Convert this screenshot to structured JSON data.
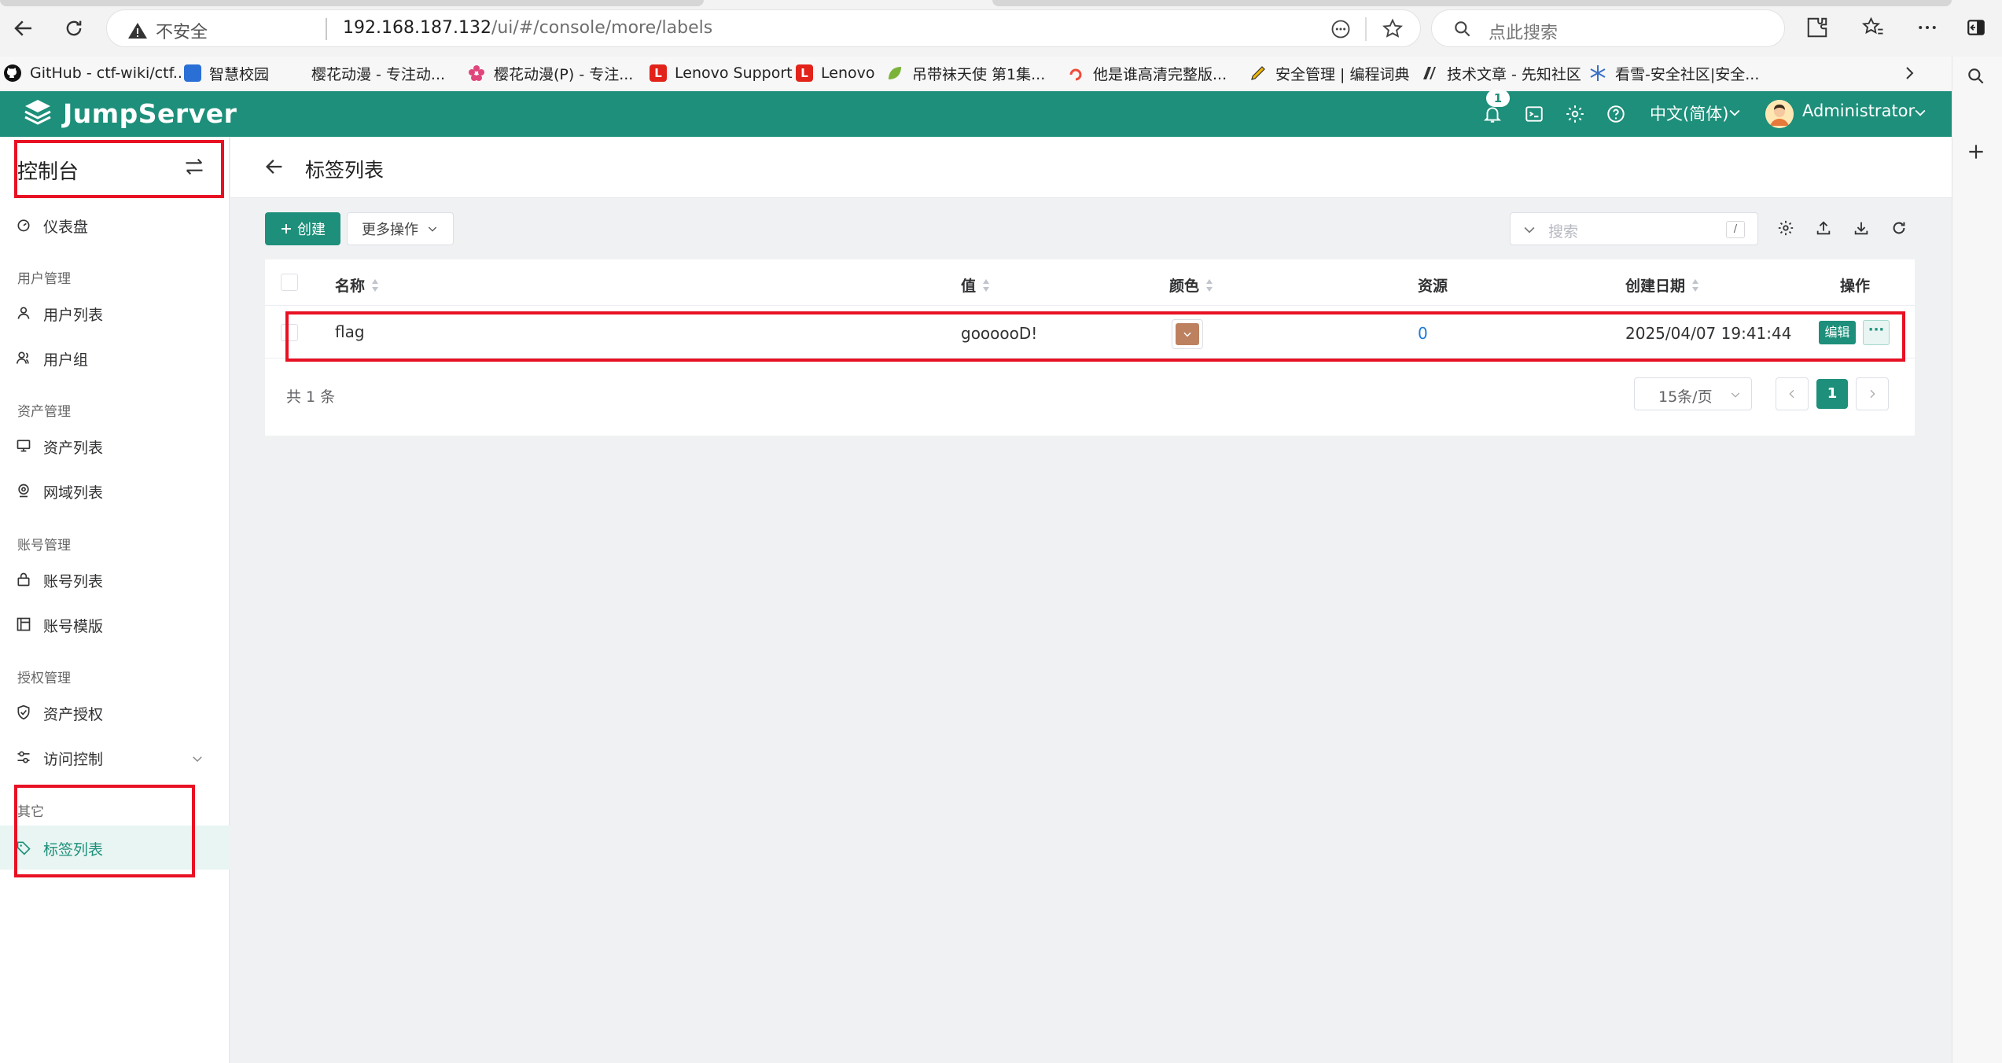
{
  "browser": {
    "insecure_label": "不安全",
    "url_host": "192.168.187.132",
    "url_path": "/ui/#/console/more/labels",
    "search_placeholder": "点此搜索"
  },
  "bookmarks": [
    {
      "label": "GitHub - ctf-wiki/ctf...",
      "icon": "github-icon",
      "color": "#111111"
    },
    {
      "label": "智慧校园",
      "icon": "campus-icon",
      "color": "#2a6fd6"
    },
    {
      "label": "樱花动漫 - 专注动...",
      "icon": "blank-icon",
      "color": "#f7f7f7"
    },
    {
      "label": "樱花动漫(P) - 专注...",
      "icon": "sakura-icon",
      "color": "#e0457b"
    },
    {
      "label": "Lenovo Support",
      "icon": "lenovo-icon",
      "color": "#e2231a"
    },
    {
      "label": "Lenovo",
      "icon": "lenovo-icon",
      "color": "#e2231a"
    },
    {
      "label": "吊带袜天使 第1集...",
      "icon": "leaf-icon",
      "color": "#7bb33a"
    },
    {
      "label": "他是谁高清完整版...",
      "icon": "swirl-icon",
      "color": "#ef4b3b"
    },
    {
      "label": "安全管理 | 编程词典",
      "icon": "pen-icon",
      "color": "#f2b705"
    },
    {
      "label": "技术文章 - 先知社区",
      "icon": "slash-icon",
      "color": "#333333"
    },
    {
      "label": "看雪-安全社区|安全...",
      "icon": "snow-icon",
      "color": "#3a6fc4"
    }
  ],
  "header": {
    "brand": "JumpServer",
    "notification_count": "1",
    "language": "中文(简体)",
    "user": "Administrator",
    "brand_color": "#1d8f7a"
  },
  "sidebar": {
    "title": "控制台",
    "dashboard": "仪表盘",
    "groups": {
      "users": "用户管理",
      "assets": "资产管理",
      "accounts": "账号管理",
      "perms": "授权管理",
      "other": "其它"
    },
    "items": {
      "user_list": "用户列表",
      "user_group": "用户组",
      "asset_list": "资产列表",
      "domain_list": "网域列表",
      "account_list": "账号列表",
      "account_template": "账号模版",
      "asset_perm": "资产授权",
      "access_control": "访问控制",
      "label_list": "标签列表"
    }
  },
  "page": {
    "title": "标签列表",
    "create_label": "创建",
    "more_actions": "更多操作",
    "search_placeholder": "搜索",
    "search_shortcut": "/"
  },
  "table": {
    "headers": {
      "name": "名称",
      "value": "值",
      "color": "颜色",
      "resources": "资源",
      "created": "创建日期",
      "actions": "操作"
    },
    "rows": [
      {
        "name": "flag",
        "value": "goooooD!",
        "color": "#bd8160",
        "resources": "0",
        "created": "2025/04/07 19:41:44",
        "edit_label": "编辑",
        "more_label": "···"
      }
    ]
  },
  "pagination": {
    "total": "共 1 条",
    "page_size": "15条/页",
    "current_page": "1"
  }
}
